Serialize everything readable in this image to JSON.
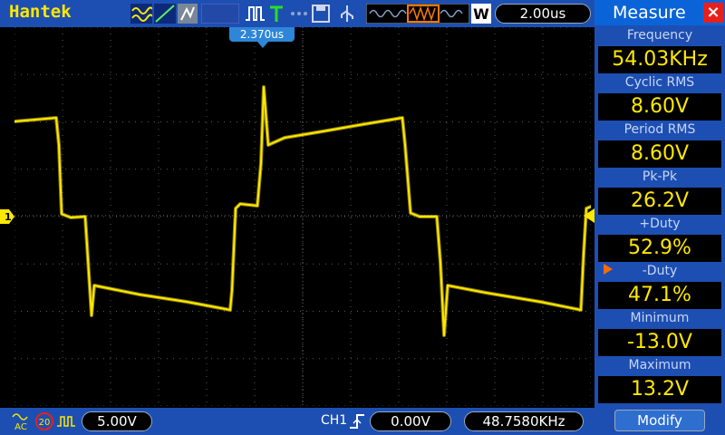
{
  "header": {
    "brand": "Hantek",
    "time_base": "2.00us",
    "trigger_position": "2.370us",
    "icons": [
      "waveform-icon",
      "ramp-icon",
      "persistence-icon",
      "pulse-icon",
      "trigger-t-icon",
      "dots-icon",
      "save-icon",
      "usb-icon",
      "memory-waveform-icon",
      "w-zoom-icon"
    ]
  },
  "footer": {
    "coupling": "AC",
    "bw_limit": "20",
    "ch1_volts": "5.00V",
    "trigger_source": "CH1",
    "trigger_level": "0.00V",
    "trigger_frequency": "48.7580KHz"
  },
  "measure": {
    "title": "Measure",
    "items": [
      {
        "label": "Frequency",
        "value": "54.03KHz"
      },
      {
        "label": "Cyclic RMS",
        "value": "8.60V"
      },
      {
        "label": "Period RMS",
        "value": "8.60V"
      },
      {
        "label": "Pk-Pk",
        "value": "26.2V"
      },
      {
        "label": "+Duty",
        "value": "52.9%"
      },
      {
        "label": "-Duty",
        "value": "47.1%"
      },
      {
        "label": "Minimum",
        "value": "-13.0V"
      },
      {
        "label": "Maximum",
        "value": "13.2V"
      }
    ],
    "modify_label": "Modify"
  },
  "colors": {
    "trace": "#ffe800",
    "bar": "#1d4fb3",
    "accent": "#2e86d8"
  }
}
